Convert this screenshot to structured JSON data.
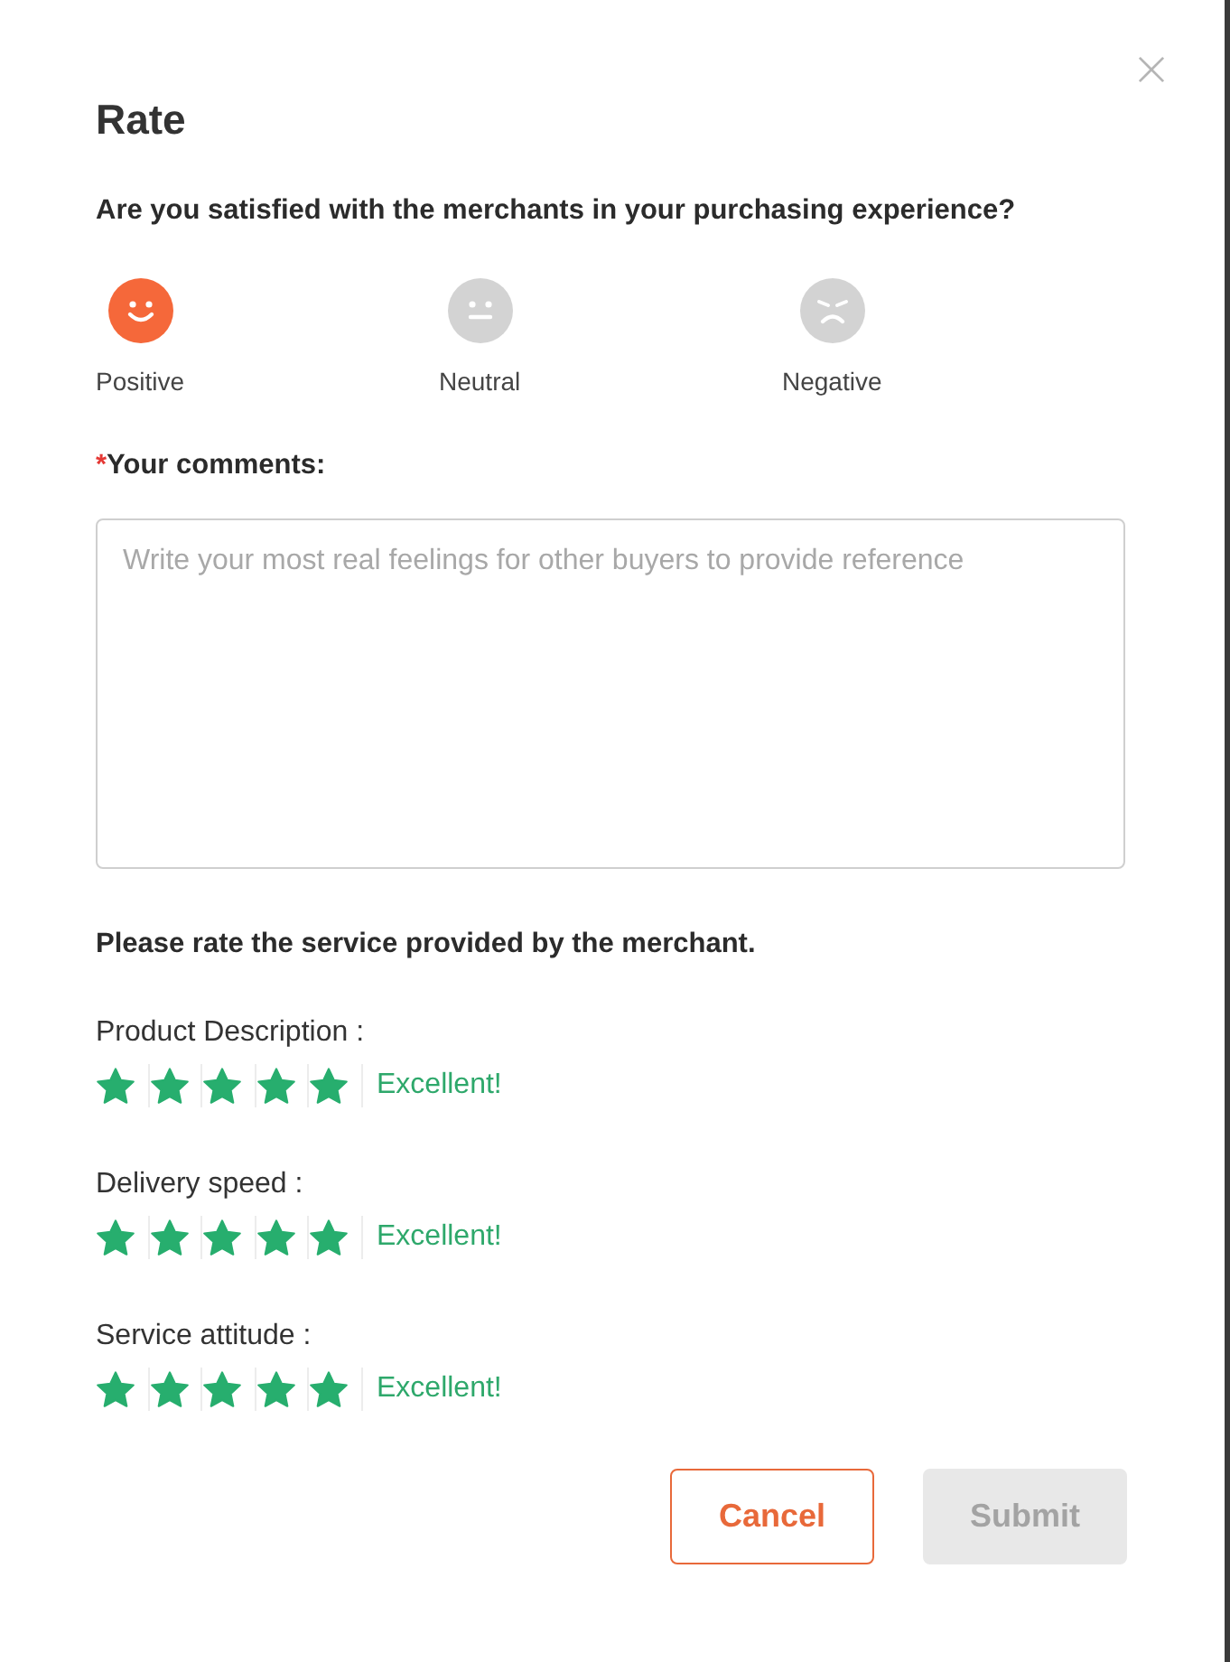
{
  "dialog": {
    "title": "Rate"
  },
  "question": "Are you satisfied with the merchants in your purchasing experience?",
  "moods": [
    {
      "kind": "positive",
      "label": "Positive",
      "selected": true
    },
    {
      "kind": "neutral",
      "label": "Neutral",
      "selected": false
    },
    {
      "kind": "negative",
      "label": "Negative",
      "selected": false
    }
  ],
  "comments": {
    "required_mark": "*",
    "label": "Your comments:",
    "placeholder": "Write your most real feelings for other buyers to provide reference"
  },
  "service": {
    "heading": "Please rate the service provided by the merchant.",
    "ratings": [
      {
        "label": "Product Description :",
        "stars": 5,
        "verdict": "Excellent!"
      },
      {
        "label": "Delivery speed :",
        "stars": 5,
        "verdict": "Excellent!"
      },
      {
        "label": "Service attitude :",
        "stars": 5,
        "verdict": "Excellent!"
      }
    ]
  },
  "buttons": [
    {
      "kind": "cancel",
      "label": "Cancel",
      "disabled": false
    },
    {
      "kind": "submit",
      "label": "Submit",
      "disabled": true
    }
  ]
}
